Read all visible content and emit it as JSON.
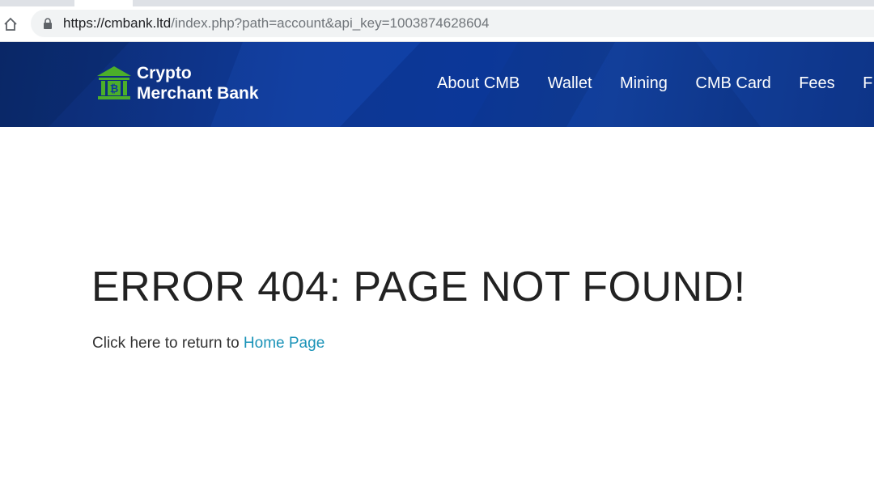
{
  "browser": {
    "url_host": "https://cmbank.ltd",
    "url_path": "/index.php?path=account&api_key=1003874628604"
  },
  "header": {
    "logo_line1": "Crypto",
    "logo_line2": "Merchant Bank",
    "nav": [
      "About CMB",
      "Wallet",
      "Mining",
      "CMB Card",
      "Fees",
      "F"
    ]
  },
  "main": {
    "title": "ERROR 404: PAGE NOT FOUND!",
    "return_prefix": "Click here to return to ",
    "home_link": "Home Page"
  },
  "colors": {
    "header_bg": "#0f3a99",
    "logo_green": "#4caf2a",
    "link": "#1a93b8"
  }
}
